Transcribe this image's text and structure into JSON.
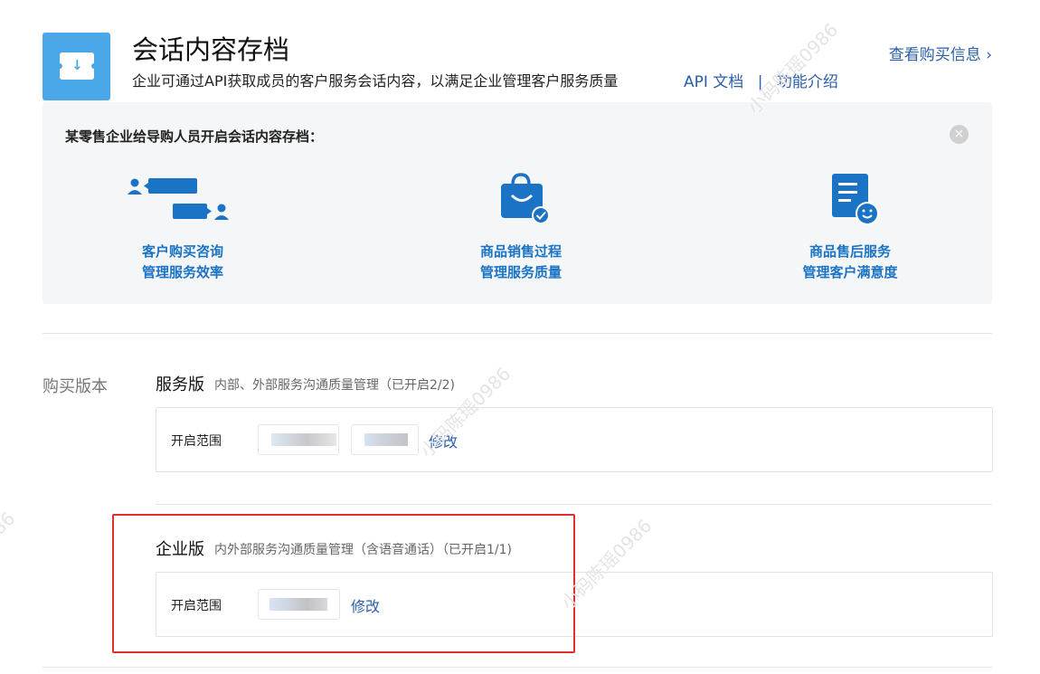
{
  "header": {
    "title": "会话内容存档",
    "subtitle": "企业可通过API获取成员的客户服务会话内容，以满足企业管理客户服务质量",
    "api_doc_link": "API 文档",
    "separator": "|",
    "features_link": "功能介绍",
    "purchase_info_link": "查看购买信息",
    "purchase_info_arrow": "›"
  },
  "promo": {
    "title": "某零售企业给导购人员开启会话内容存档：",
    "close_glyph": "×",
    "features": [
      {
        "line1": "客户购买咨询",
        "line2": "管理服务效率",
        "icon": "chat-people-icon"
      },
      {
        "line1": "商品销售过程",
        "line2": "管理服务质量",
        "icon": "shopping-bag-check-icon"
      },
      {
        "line1": "商品售后服务",
        "line2": "管理客户满意度",
        "icon": "document-smile-icon"
      }
    ]
  },
  "purchase": {
    "section_label": "购买版本",
    "plans": [
      {
        "name": "服务版",
        "description": "内部、外部服务沟通质量管理（已开启2/2)",
        "scope_label": "开启范围",
        "edit_label": "修改"
      },
      {
        "name": "企业版",
        "description": "内外部服务沟通质量管理（含语音通话）（已开启1/1)",
        "scope_label": "开启范围",
        "edit_label": "修改"
      }
    ]
  },
  "watermark": "小码陈瑶0986",
  "colors": {
    "accent_blue": "#1a73c4",
    "link_blue": "#2a5fa8",
    "app_icon_bg": "#4aa8e8",
    "promo_bg": "#f5f6f7",
    "highlight_red": "#e0302d"
  }
}
